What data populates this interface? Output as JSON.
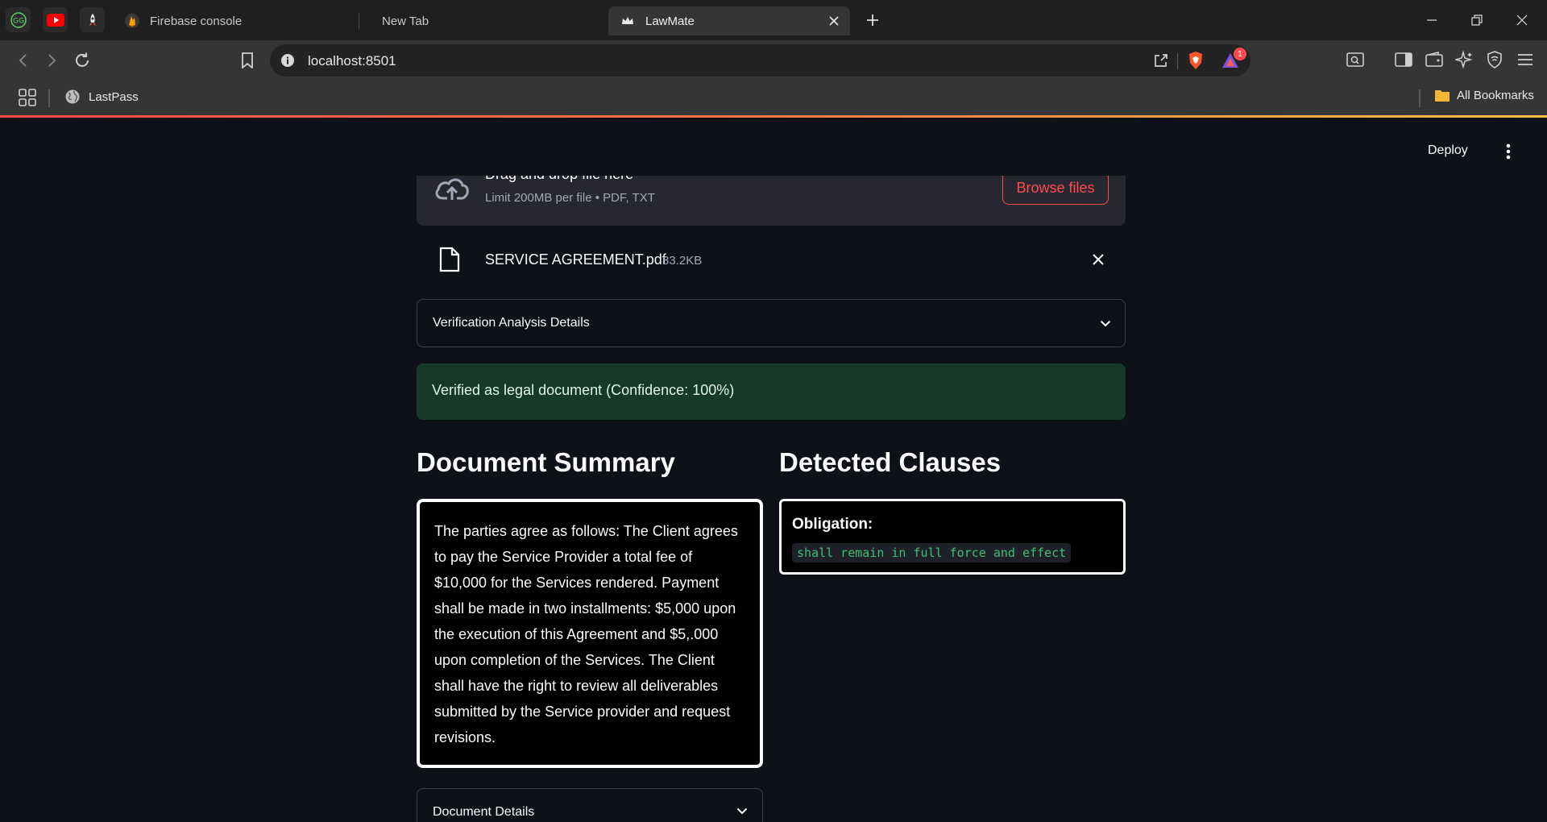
{
  "browser": {
    "tabs": [
      {
        "label": "Firebase console"
      },
      {
        "label": "New Tab"
      },
      {
        "label": "LawMate"
      }
    ],
    "url": "localhost:8501",
    "notification_count": "1",
    "bookmarks": [
      {
        "label": "LastPass"
      }
    ],
    "all_bookmarks_label": "All Bookmarks"
  },
  "app": {
    "deploy_label": "Deploy",
    "uploader": {
      "title": "Drag and drop file here",
      "limit": "Limit 200MB per file • PDF, TXT",
      "browse_label": "Browse files"
    },
    "file": {
      "name": "SERVICE AGREEMENT.pdf",
      "size": "83.2KB"
    },
    "verification_expander": "Verification Analysis Details",
    "success_message": "Verified as legal document (Confidence: 100%)",
    "summary_heading": "Document Summary",
    "summary_text": "The parties agree as follows: The Client agrees to pay the Service Provider a total fee of $10,000 for the Services rendered. Payment shall be made in two installments: $5,000 upon the execution of this Agreement and $5,.000 upon completion of the Services. The Client shall have the right to review all deliverables submitted by the Service provider and request revisions.",
    "clauses_heading": "Detected Clauses",
    "clauses": [
      {
        "type": "Obligation:",
        "text": "shall remain in full force and effect"
      }
    ],
    "details_expander": "Document Details"
  },
  "colors": {
    "accent": "#ff4b4b",
    "success_bg": "#173928",
    "background": "#0e1117",
    "code_green": "#3fbf74"
  }
}
